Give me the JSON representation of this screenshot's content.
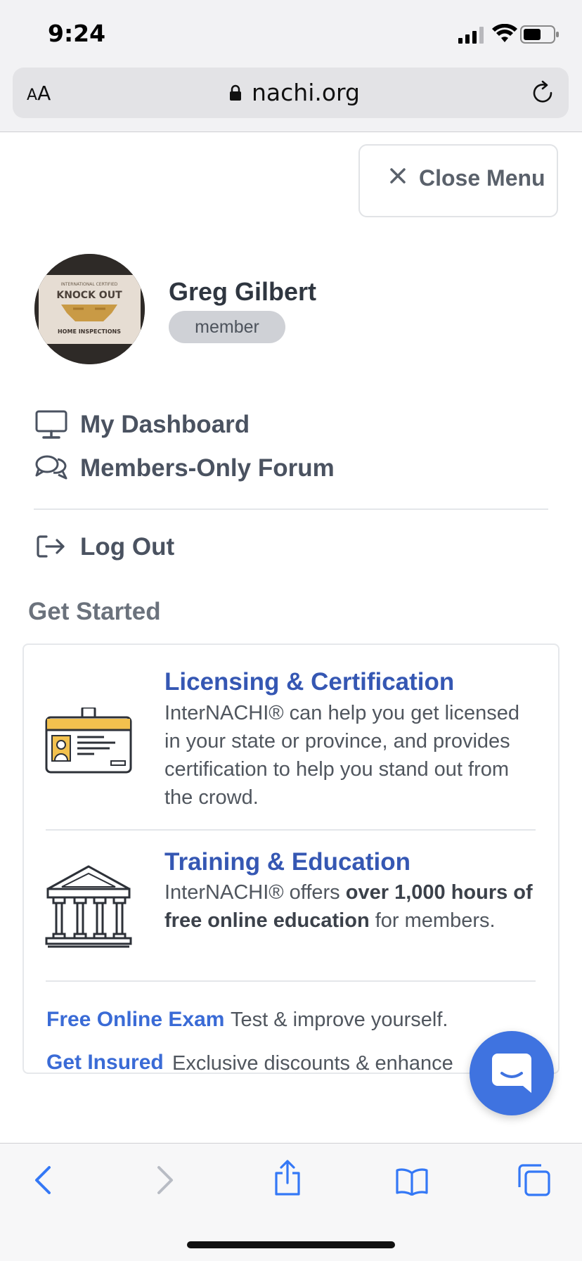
{
  "status_bar": {
    "time": "9:24"
  },
  "browser": {
    "aa_label_small": "A",
    "aa_label_large": "A",
    "url": "nachi.org"
  },
  "menu": {
    "close_label": "Close Menu",
    "user": {
      "name": "Greg Gilbert",
      "role": "member"
    },
    "avatar_text": {
      "top": "INTERNATIONAL CERTIFIED",
      "main": "KNOCK OUT",
      "bottom": "HOME INSPECTIONS"
    },
    "items": [
      {
        "label": "My Dashboard",
        "icon": "monitor-icon"
      },
      {
        "label": "Members-Only Forum",
        "icon": "chat-bubbles-icon"
      },
      {
        "label": "Log Out",
        "icon": "sign-out-icon"
      }
    ],
    "section_title": "Get Started",
    "cards": [
      {
        "title": "Licensing & Certification",
        "text": "InterNACHI® can help you get licensed in your state or province, and provides certification to help you stand out from the crowd.",
        "icon": "id-badge-icon"
      },
      {
        "title": "Training & Education",
        "text_before": "InterNACHI® offers ",
        "text_bold": "over 1,000 hours of free online education",
        "text_after": " for members.",
        "icon": "building-columns-icon"
      }
    ],
    "links": [
      {
        "title": "Free Online Exam",
        "text": "Test & improve yourself."
      },
      {
        "title": "Get Insured",
        "text": "Exclusive discounts & enhance"
      }
    ]
  },
  "colors": {
    "accent_blue": "#3557b3",
    "link_blue": "#3a6bd6",
    "chat_blue": "#3f73e0",
    "ios_blue": "#3478f6"
  }
}
